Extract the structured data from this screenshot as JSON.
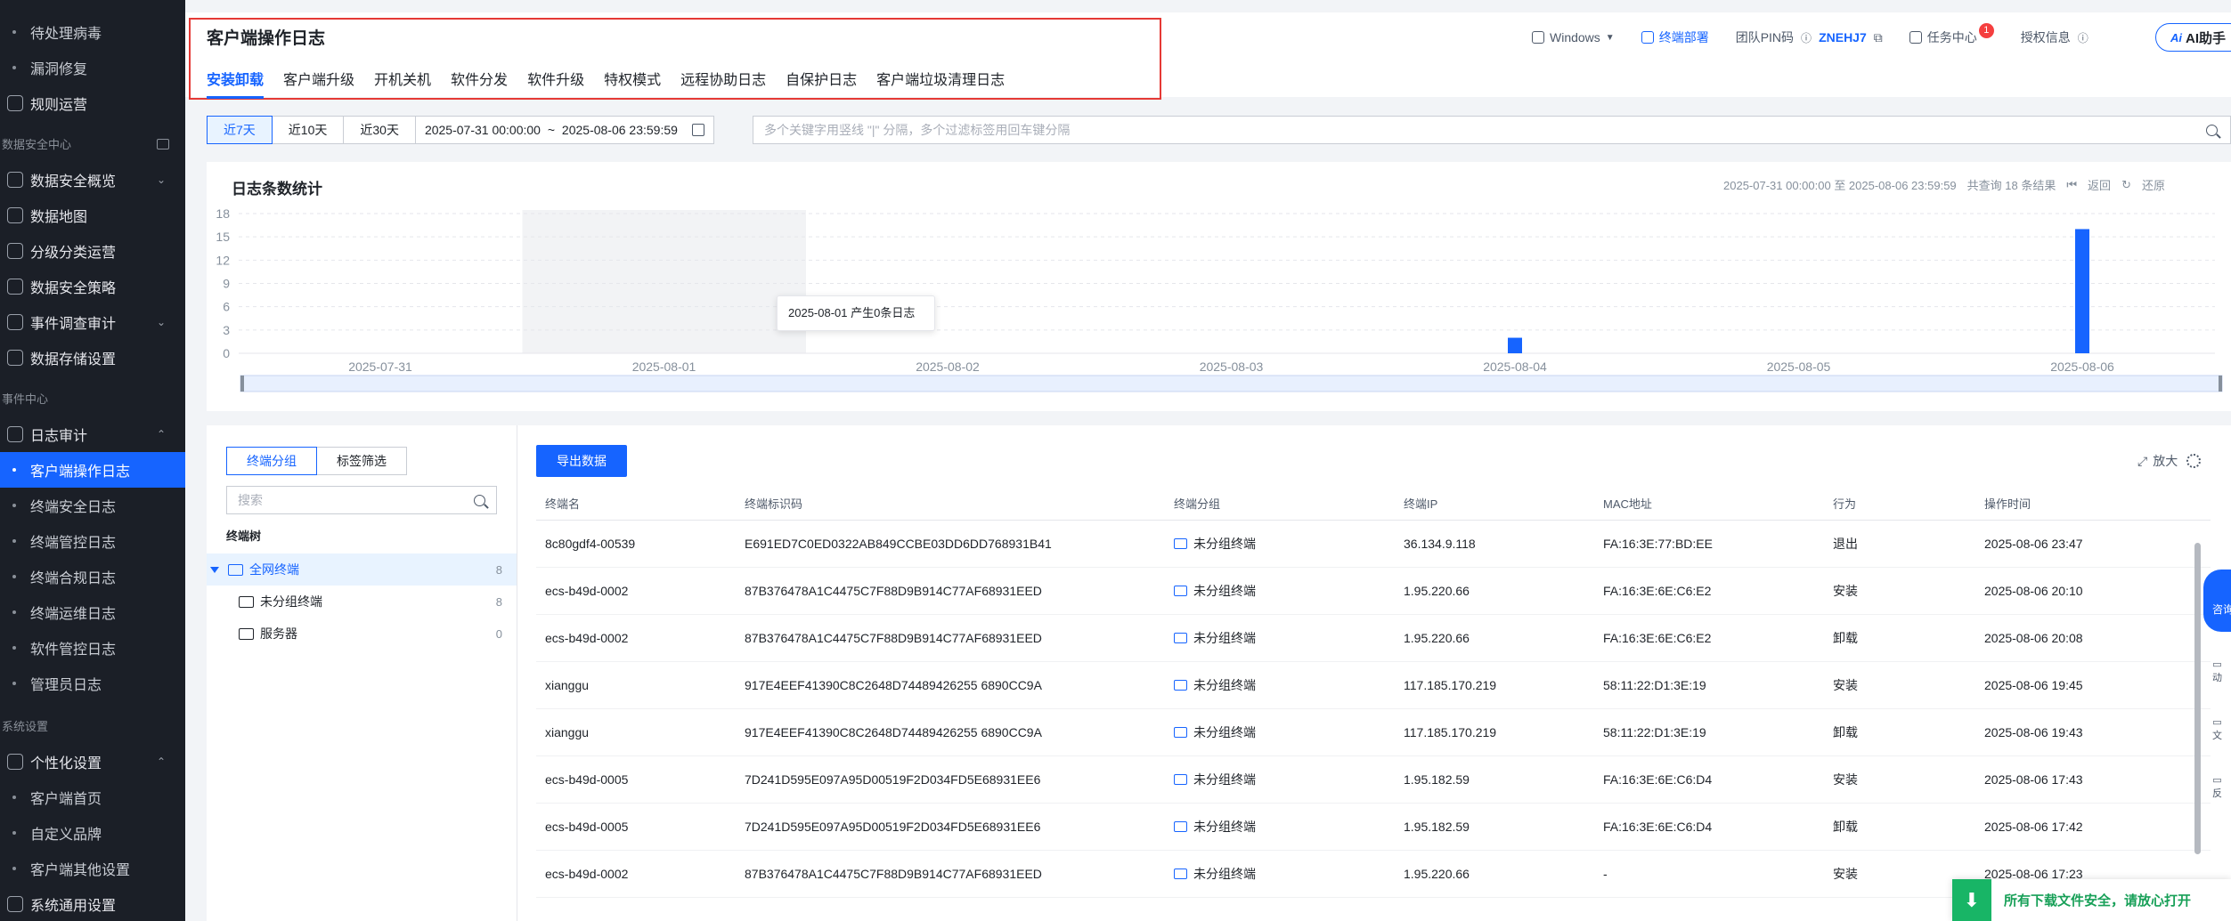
{
  "sidebar": {
    "items": [
      {
        "label": "待处理病毒",
        "kind": "sub"
      },
      {
        "label": "漏洞修复",
        "kind": "sub"
      },
      {
        "label": "规则运营",
        "kind": "top"
      },
      {
        "label": "数据安全中心",
        "kind": "section"
      },
      {
        "label": "数据安全概览",
        "kind": "top",
        "chevron": "⌄"
      },
      {
        "label": "数据地图",
        "kind": "top"
      },
      {
        "label": "分级分类运营",
        "kind": "top"
      },
      {
        "label": "数据安全策略",
        "kind": "top"
      },
      {
        "label": "事件调查审计",
        "kind": "top",
        "chevron": "⌄"
      },
      {
        "label": "数据存储设置",
        "kind": "top"
      },
      {
        "label": "事件中心",
        "kind": "section"
      },
      {
        "label": "日志审计",
        "kind": "top",
        "chevron": "⌃"
      },
      {
        "label": "客户端操作日志",
        "kind": "sub",
        "active": true
      },
      {
        "label": "终端安全日志",
        "kind": "sub"
      },
      {
        "label": "终端管控日志",
        "kind": "sub"
      },
      {
        "label": "终端合规日志",
        "kind": "sub"
      },
      {
        "label": "终端运维日志",
        "kind": "sub"
      },
      {
        "label": "软件管控日志",
        "kind": "sub"
      },
      {
        "label": "管理员日志",
        "kind": "sub"
      },
      {
        "label": "系统设置",
        "kind": "section"
      },
      {
        "label": "个性化设置",
        "kind": "top",
        "chevron": "⌃"
      },
      {
        "label": "客户端首页",
        "kind": "sub"
      },
      {
        "label": "自定义品牌",
        "kind": "sub"
      },
      {
        "label": "客户端其他设置",
        "kind": "sub"
      },
      {
        "label": "系统通用设置",
        "kind": "top"
      }
    ]
  },
  "header": {
    "title": "客户端操作日志",
    "tabs": [
      "安装卸载",
      "客户端升级",
      "开机关机",
      "软件分发",
      "软件升级",
      "特权模式",
      "远程协助日志",
      "自保护日志",
      "客户端垃圾清理日志"
    ],
    "active_tab": 0
  },
  "top_right": {
    "os": "Windows",
    "deploy": "终端部署",
    "pin_label": "团队PIN码",
    "pin_value": "ZNEHJ7",
    "task_center": "任务中心",
    "task_badge": "1",
    "license": "授权信息",
    "ai": "AI助手"
  },
  "filter": {
    "quick": [
      "近7天",
      "近10天",
      "近30天"
    ],
    "active_quick": 0,
    "date_start": "2025-07-31 00:00:00",
    "date_end": "2025-08-06 23:59:59",
    "search_placeholder": "多个关键字用竖线 \"|\" 分隔，多个过滤标签用回车键分隔"
  },
  "chart_meta": {
    "title": "日志条数统计",
    "range_text": "2025-07-31 00:00:00 至 2025-08-06 23:59:59",
    "total_text": "共查询 18 条结果",
    "back": "返回",
    "reset": "还原",
    "tooltip": "2025-08-01 产生0条日志"
  },
  "chart_data": {
    "type": "bar",
    "title": "日志条数统计",
    "categories": [
      "2025-07-31",
      "2025-08-01",
      "2025-08-02",
      "2025-08-03",
      "2025-08-04",
      "2025-08-05",
      "2025-08-06"
    ],
    "values": [
      0,
      0,
      0,
      0,
      2,
      0,
      16
    ],
    "ylim": [
      0,
      18
    ],
    "yticks": [
      0,
      3,
      6,
      9,
      12,
      15,
      18
    ],
    "grid": true,
    "bar_color": "#1664ff",
    "highlight_category": "2025-08-01"
  },
  "tree": {
    "tabs": [
      "终端分组",
      "标签筛选"
    ],
    "search_placeholder": "搜索",
    "label": "终端树",
    "nodes": [
      {
        "label": "全网终端",
        "count": "8",
        "selected": true
      },
      {
        "label": "未分组终端",
        "count": "8"
      },
      {
        "label": "服务器",
        "count": "0"
      }
    ]
  },
  "table": {
    "export": "导出数据",
    "zoom": "放大",
    "columns": [
      "终端名",
      "终端标识码",
      "终端分组",
      "终端IP",
      "MAC地址",
      "行为",
      "操作时间"
    ],
    "rows": [
      [
        "8c80gdf4-00539",
        "E691ED7C0ED0322AB849CCBE03DD6DD768931B41",
        "未分组终端",
        "36.134.9.118",
        "FA:16:3E:77:BD:EE",
        "退出",
        "2025-08-06 23:47"
      ],
      [
        "ecs-b49d-0002",
        "87B376478A1C4475C7F88D9B914C77AF68931EED",
        "未分组终端",
        "1.95.220.66",
        "FA:16:3E:6E:C6:E2",
        "安装",
        "2025-08-06 20:10"
      ],
      [
        "ecs-b49d-0002",
        "87B376478A1C4475C7F88D9B914C77AF68931EED",
        "未分组终端",
        "1.95.220.66",
        "FA:16:3E:6E:C6:E2",
        "卸载",
        "2025-08-06 20:08"
      ],
      [
        "xianggu",
        "917E4EEF41390C8C2648D74489426255 6890CC9A",
        "未分组终端",
        "117.185.170.219",
        "58:11:22:D1:3E:19",
        "安装",
        "2025-08-06 19:45"
      ],
      [
        "xianggu",
        "917E4EEF41390C8C2648D74489426255 6890CC9A",
        "未分组终端",
        "117.185.170.219",
        "58:11:22:D1:3E:19",
        "卸载",
        "2025-08-06 19:43"
      ],
      [
        "ecs-b49d-0005",
        "7D241D595E097A95D00519F2D034FD5E68931EE6",
        "未分组终端",
        "1.95.182.59",
        "FA:16:3E:6E:C6:D4",
        "安装",
        "2025-08-06 17:43"
      ],
      [
        "ecs-b49d-0005",
        "7D241D595E097A95D00519F2D034FD5E68931EE6",
        "未分组终端",
        "1.95.182.59",
        "FA:16:3E:6E:C6:D4",
        "卸载",
        "2025-08-06 17:42"
      ],
      [
        "ecs-b49d-0002",
        "87B376478A1C4475C7F88D9B914C77AF68931EED",
        "未分组终端",
        "1.95.220.66",
        "-",
        "安装",
        "2025-08-06 17:23"
      ]
    ]
  },
  "side_float": {
    "consult": "咨询",
    "items": [
      "动",
      "文",
      "反"
    ]
  },
  "download_toast": {
    "icon": "⬇",
    "message": "所有下载文件安全，请放心打开"
  }
}
